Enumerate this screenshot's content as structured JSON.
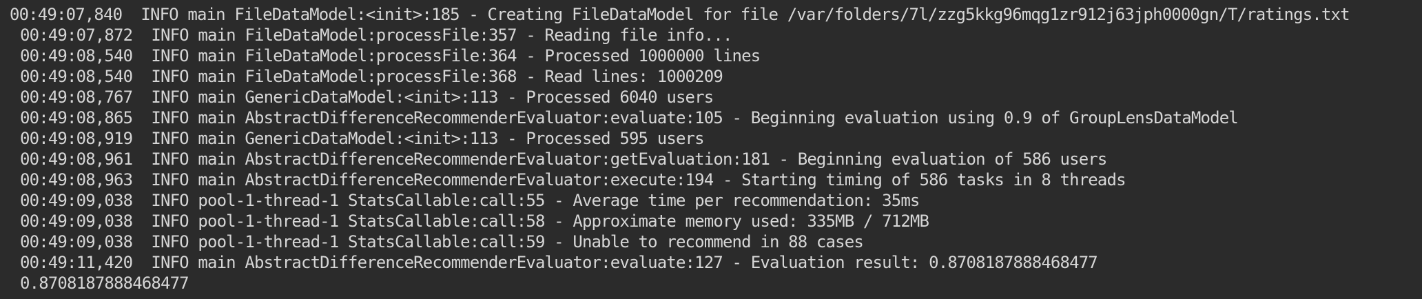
{
  "terminal": {
    "clipped_line": "                                                                                               ",
    "lines": [
      "00:49:07,840  INFO main FileDataModel:<init>:185 - Creating FileDataModel for file /var/folders/7l/zzg5kkg96mqg1zr912j63jph0000gn/T/ratings.txt",
      "00:49:07,872  INFO main FileDataModel:processFile:357 - Reading file info...",
      "00:49:08,540  INFO main FileDataModel:processFile:364 - Processed 1000000 lines",
      "00:49:08,540  INFO main FileDataModel:processFile:368 - Read lines: 1000209",
      "00:49:08,767  INFO main GenericDataModel:<init>:113 - Processed 6040 users",
      "00:49:08,865  INFO main AbstractDifferenceRecommenderEvaluator:evaluate:105 - Beginning evaluation using 0.9 of GroupLensDataModel",
      "00:49:08,919  INFO main GenericDataModel:<init>:113 - Processed 595 users",
      "00:49:08,961  INFO main AbstractDifferenceRecommenderEvaluator:getEvaluation:181 - Beginning evaluation of 586 users",
      "00:49:08,963  INFO main AbstractDifferenceRecommenderEvaluator:execute:194 - Starting timing of 586 tasks in 8 threads",
      "00:49:09,038  INFO pool-1-thread-1 StatsCallable:call:55 - Average time per recommendation: 35ms",
      "00:49:09,038  INFO pool-1-thread-1 StatsCallable:call:58 - Approximate memory used: 335MB / 712MB",
      "00:49:09,038  INFO pool-1-thread-1 StatsCallable:call:59 - Unable to recommend in 88 cases",
      "00:49:11,420  INFO main AbstractDifferenceRecommenderEvaluator:evaluate:127 - Evaluation result: 0.8708187888468477",
      "0.8708187888468477"
    ]
  }
}
